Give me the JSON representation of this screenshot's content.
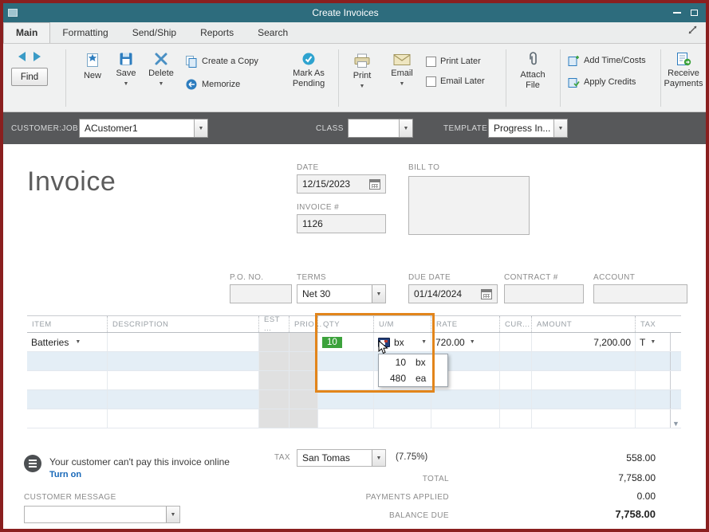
{
  "window": {
    "title": "Create Invoices"
  },
  "tabs": [
    {
      "label": "Main"
    },
    {
      "label": "Formatting"
    },
    {
      "label": "Send/Ship"
    },
    {
      "label": "Reports"
    },
    {
      "label": "Search"
    }
  ],
  "toolbar": {
    "find": "Find",
    "new": "New",
    "save": "Save",
    "delete": "Delete",
    "create_copy": "Create a Copy",
    "memorize": "Memorize",
    "mark_pending": "Mark As Pending",
    "print": "Print",
    "email": "Email",
    "print_later": "Print Later",
    "email_later": "Email Later",
    "attach_file": "Attach File",
    "add_time_costs": "Add Time/Costs",
    "apply_credits": "Apply Credits",
    "receive_payments": "Receive Payments"
  },
  "customer_bar": {
    "customer_label": "CUSTOMER:JOB",
    "customer_value": "ACustomer1",
    "class_label": "CLASS",
    "class_value": "",
    "template_label": "TEMPLATE",
    "template_value": "Progress In..."
  },
  "invoice": {
    "title": "Invoice",
    "date_label": "DATE",
    "date_value": "12/15/2023",
    "invoice_no_label": "INVOICE #",
    "invoice_no_value": "1126",
    "bill_to_label": "BILL TO",
    "po_label": "P.O. NO.",
    "po_value": "",
    "terms_label": "TERMS",
    "terms_value": "Net 30",
    "due_date_label": "DUE DATE",
    "due_date_value": "01/14/2024",
    "contract_label": "CONTRACT #",
    "contract_value": "",
    "account_label": "ACCOUNT",
    "account_value": ""
  },
  "table": {
    "headers": [
      "ITEM",
      "DESCRIPTION",
      "EST ...",
      "PRIO...",
      "QTY",
      "U/M",
      "RATE",
      "CUR...",
      "AMOUNT",
      "TAX"
    ],
    "rows": [
      {
        "item": "Batteries",
        "description": "",
        "qty": "10",
        "um": "bx",
        "rate": "720.00",
        "cur": "",
        "amount": "7,200.00",
        "tax": "T"
      }
    ],
    "um_popup": {
      "options": [
        {
          "qty": "10",
          "unit": "bx"
        },
        {
          "qty": "480",
          "unit": "ea"
        }
      ]
    }
  },
  "footer": {
    "online_message": "Your customer can't pay this invoice online",
    "turn_on": "Turn on",
    "customer_message_label": "CUSTOMER MESSAGE",
    "customer_message_value": "",
    "tax_label": "TAX",
    "tax_value": "San Tomas",
    "tax_rate": "(7.75%)",
    "tax_amount": "558.00",
    "total_label": "TOTAL",
    "total_value": "7,758.00",
    "payments_label": "PAYMENTS APPLIED",
    "payments_value": "0.00",
    "balance_label": "BALANCE DUE",
    "balance_value": "7,758.00"
  },
  "colors": {
    "window_border": "#8a1f1f",
    "titlebar": "#2d6c7d",
    "customer_bar": "#57585a",
    "highlight_orange": "#e2851b",
    "qty_selection_green": "#3ca23c"
  }
}
